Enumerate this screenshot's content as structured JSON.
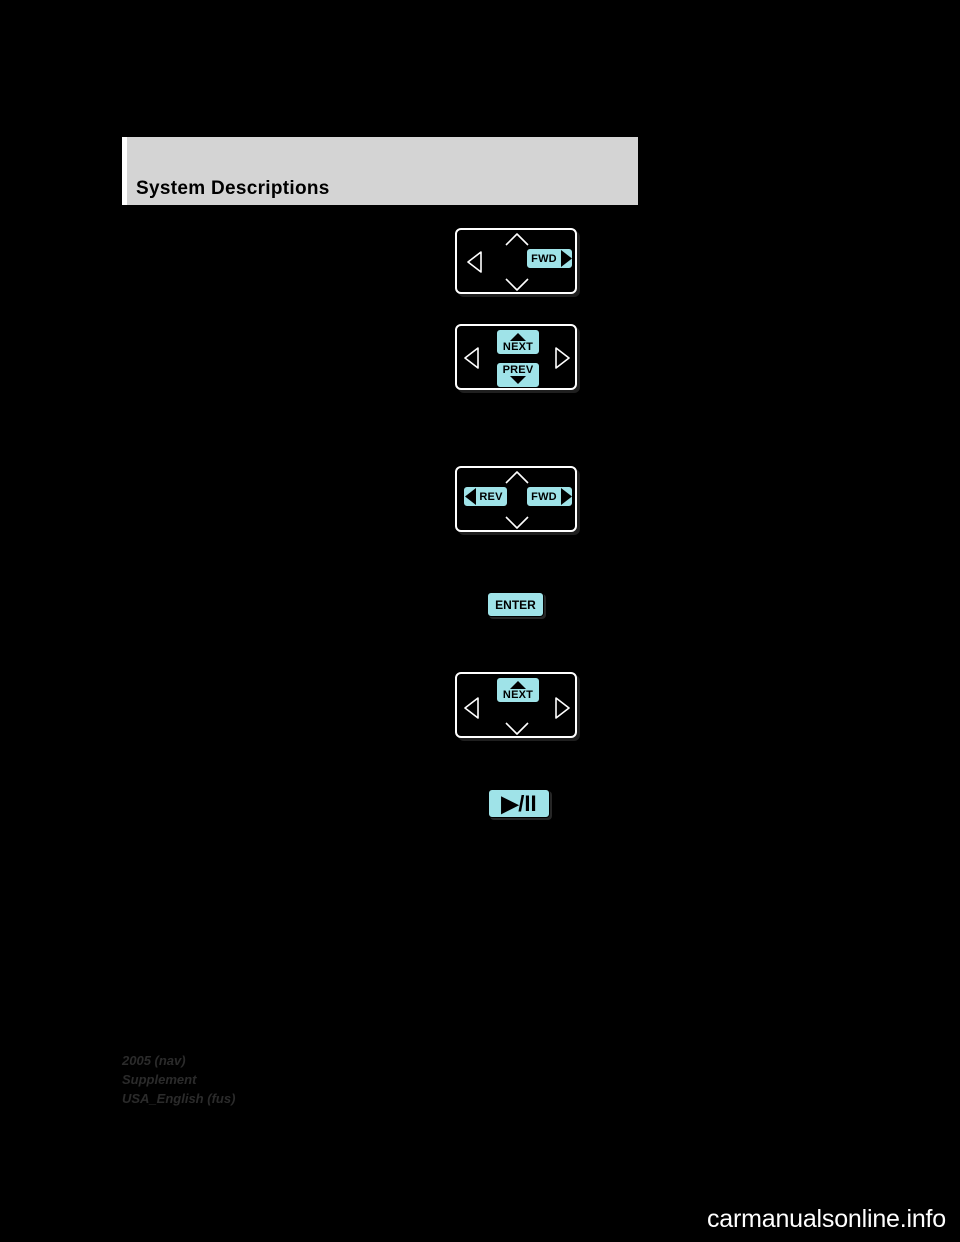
{
  "page": {
    "background_color": "#000000",
    "header": {
      "title": "System Descriptions",
      "band_color": "#d4d4d4"
    },
    "footer": {
      "line1": "2005 (nav)",
      "line2": "Supplement",
      "line3": "USA_English (fus)"
    },
    "watermark": "carmanualsonline.info",
    "accent_color": "#9fe3e8"
  },
  "graphics": [
    {
      "name": "fwd-control-panel",
      "keys": [
        {
          "label": "FWD",
          "arrow": "right"
        }
      ],
      "outline_arrows": [
        "left",
        "up",
        "down"
      ]
    },
    {
      "name": "next-prev-control-panel",
      "keys": [
        {
          "label": "NEXT",
          "arrow": "up"
        },
        {
          "label": "PREV",
          "arrow": "down"
        }
      ],
      "outline_arrows": [
        "left",
        "right"
      ]
    },
    {
      "name": "rev-fwd-control-panel",
      "keys": [
        {
          "label": "REV",
          "arrow": "left"
        },
        {
          "label": "FWD",
          "arrow": "right"
        }
      ],
      "outline_arrows": [
        "up",
        "down"
      ]
    },
    {
      "name": "enter-key",
      "keys": [
        {
          "label": "ENTER",
          "arrow": "none"
        }
      ]
    },
    {
      "name": "next-control-panel",
      "keys": [
        {
          "label": "NEXT",
          "arrow": "up"
        }
      ],
      "outline_arrows": [
        "left",
        "right",
        "down"
      ]
    },
    {
      "name": "play-pause-key",
      "keys": [
        {
          "label": "▶/II",
          "arrow": "none"
        }
      ]
    }
  ]
}
